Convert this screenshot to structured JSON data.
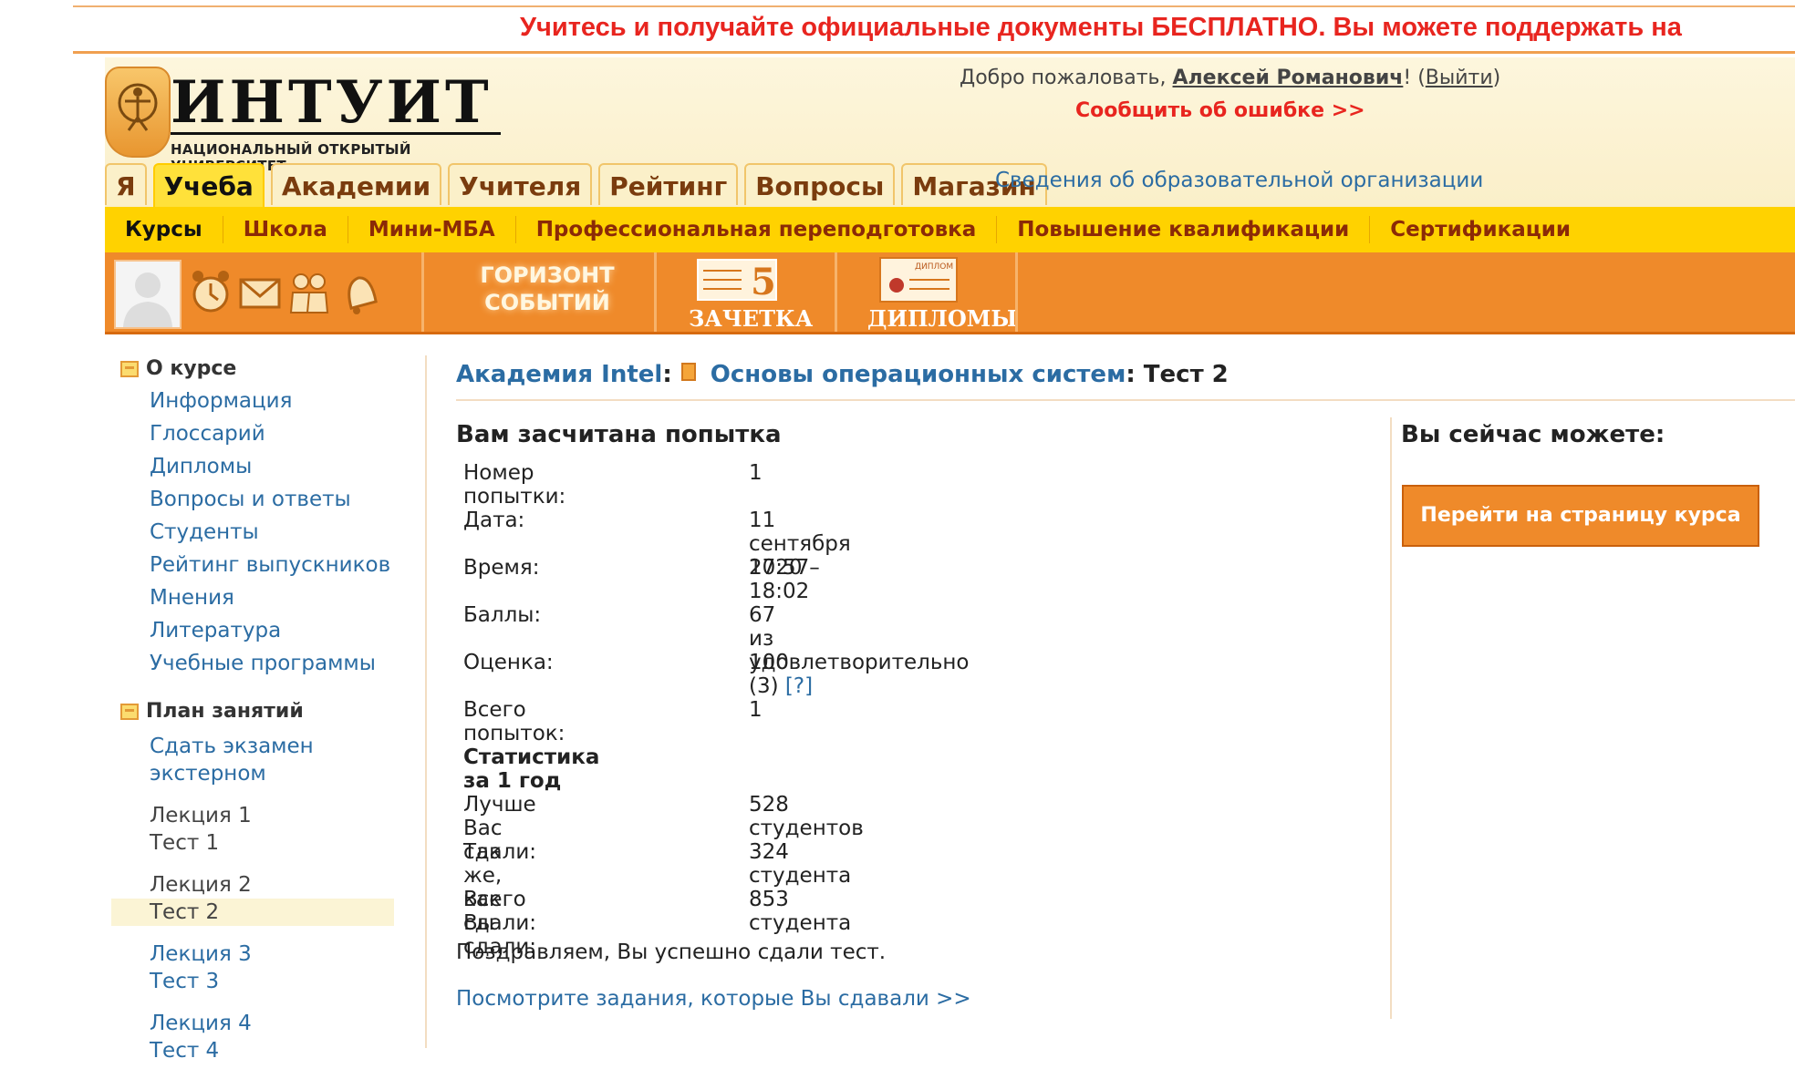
{
  "promo": {
    "text": "Учитесь и получайте официальные документы БЕСПЛАТНО. Вы можете поддержать на"
  },
  "logo": {
    "title": "ИНТУИТ",
    "subtitle": "НАЦИОНАЛЬНЫЙ ОТКРЫТЫЙ УНИВЕРСИТЕТ"
  },
  "header": {
    "welcome_prefix": "Добро пожаловать, ",
    "user_name": "Алексей Романович",
    "welcome_bang": "!",
    "logout_open": " (",
    "logout": "Выйти",
    "logout_close": ")",
    "report_error": "Сообщить об ошибке >>",
    "org_info": "Сведения об образовательной организации"
  },
  "tabs": [
    {
      "label": "Я",
      "active": false
    },
    {
      "label": "Учеба",
      "active": true
    },
    {
      "label": "Академии",
      "active": false
    },
    {
      "label": "Учителя",
      "active": false
    },
    {
      "label": "Рейтинг",
      "active": false
    },
    {
      "label": "Вопросы",
      "active": false
    },
    {
      "label": "Магазин",
      "active": false
    }
  ],
  "subnav": [
    {
      "label": "Курсы",
      "active": true
    },
    {
      "label": "Школа"
    },
    {
      "label": "Мини-МБА"
    },
    {
      "label": "Профессиональная переподготовка"
    },
    {
      "label": "Повышение квалификации"
    },
    {
      "label": "Сертификации"
    }
  ],
  "toolbar": {
    "horizon_line1": "ГОРИЗОНТ",
    "horizon_line2": "СОБЫТИЙ",
    "zachetka_label": "ЗАЧЕТКА",
    "zachetka_grade": "5",
    "diplomas_label": "ДИПЛОМЫ",
    "diploma_badge": "ДИПЛОМ",
    "icons": [
      "alarm-clock-icon",
      "mail-icon",
      "friends-icon",
      "bell-icon"
    ]
  },
  "sidebar": {
    "about_title": "О курсе",
    "about_links": [
      "Информация",
      "Глоссарий",
      "Дипломы",
      "Вопросы и ответы",
      "Студенты",
      "Рейтинг выпускников",
      "Мнения",
      "Литература",
      "Учебные программы"
    ],
    "plan_title": "План занятий",
    "exam_line1": "Сдать экзамен",
    "exam_line2": "экстерном",
    "lessons": [
      {
        "lecture": "Лекция 1",
        "test": "Тест 1"
      },
      {
        "lecture": "Лекция 2",
        "test": "Тест 2"
      },
      {
        "lecture": "Лекция 3",
        "test": "Тест 3"
      },
      {
        "lecture": "Лекция 4",
        "test": "Тест 4"
      }
    ]
  },
  "breadcrumb": {
    "academy": "Академия Intel",
    "course": "Основы операционных систем",
    "current": "Тест 2"
  },
  "result": {
    "title": "Вам засчитана попытка",
    "rows": [
      {
        "key": "Номер попытки:",
        "value": "1"
      },
      {
        "key": "Дата:",
        "value": "11 сентября 2020"
      },
      {
        "key": "Время:",
        "value": "17:57–18:02"
      },
      {
        "key": "Баллы:",
        "value": "67 из 100"
      },
      {
        "key": "Оценка:",
        "value": "удовлетворительно (3)",
        "help": "[?]"
      },
      {
        "key": "Всего попыток:",
        "value": "1"
      }
    ],
    "stats_title": "Статистика за 1 год",
    "stats": [
      {
        "key": "Лучше Вас сдали:",
        "value": "528 студентов"
      },
      {
        "key": "Так же, как Вы сдали:",
        "value": "324 студента"
      },
      {
        "key": "Всего сдали:",
        "value": "853 студента"
      }
    ],
    "congrats": "Поздравляем, Вы успешно сдали тест.",
    "view_tasks": "Посмотрите задания, которые Вы сдавали >>"
  },
  "actions": {
    "title": "Вы сейчас можете:",
    "go_course": "Перейти на страницу курса"
  },
  "colors": {
    "accent_orange": "#ef8a2a",
    "nav_yellow": "#ffd200",
    "link_blue": "#2b6ca3",
    "alert_red": "#e8251f"
  }
}
